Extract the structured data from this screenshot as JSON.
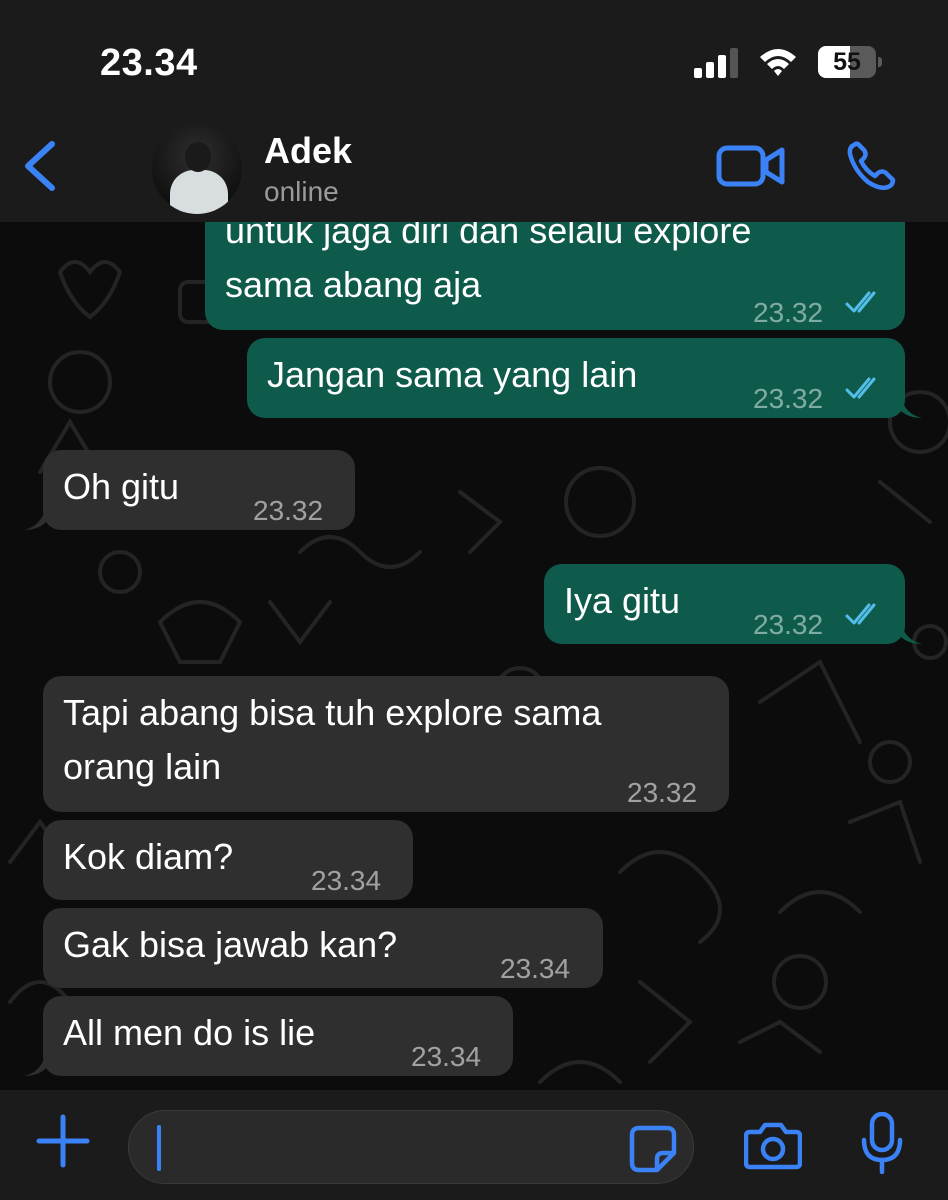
{
  "status_bar": {
    "time": "23.34",
    "battery_level": "55",
    "battery_fraction": 0.55
  },
  "header": {
    "contact_name": "Adek",
    "contact_status": "online",
    "icons": [
      "back-chevron-icon",
      "video-call-icon",
      "voice-call-icon"
    ]
  },
  "messages": [
    {
      "direction": "outgoing",
      "text": "untuk jaga diri dan selalu explore\nsama abang aja",
      "time": "23.32",
      "read": true
    },
    {
      "direction": "outgoing",
      "text": "Jangan sama yang lain",
      "time": "23.32",
      "read": true
    },
    {
      "direction": "incoming",
      "text": "Oh gitu",
      "time": "23.32"
    },
    {
      "direction": "outgoing",
      "text": "Iya gitu",
      "time": "23.32",
      "read": true
    },
    {
      "direction": "incoming",
      "text": "Tapi abang bisa tuh explore sama\norang lain",
      "time": "23.32"
    },
    {
      "direction": "incoming",
      "text": "Kok diam?",
      "time": "23.34"
    },
    {
      "direction": "incoming",
      "text": "Gak bisa jawab kan?",
      "time": "23.34"
    },
    {
      "direction": "incoming",
      "text": "All men do is lie",
      "time": "23.34"
    }
  ],
  "input_bar": {
    "message_value": "",
    "icons": [
      "plus-icon",
      "sticker-icon",
      "camera-icon",
      "microphone-icon"
    ]
  },
  "colors": {
    "accent": "#3b82f6",
    "outgoing_bubble": "#0e5b4c",
    "incoming_bubble": "#2f2f2f",
    "read_ticks": "#53bdeb"
  }
}
